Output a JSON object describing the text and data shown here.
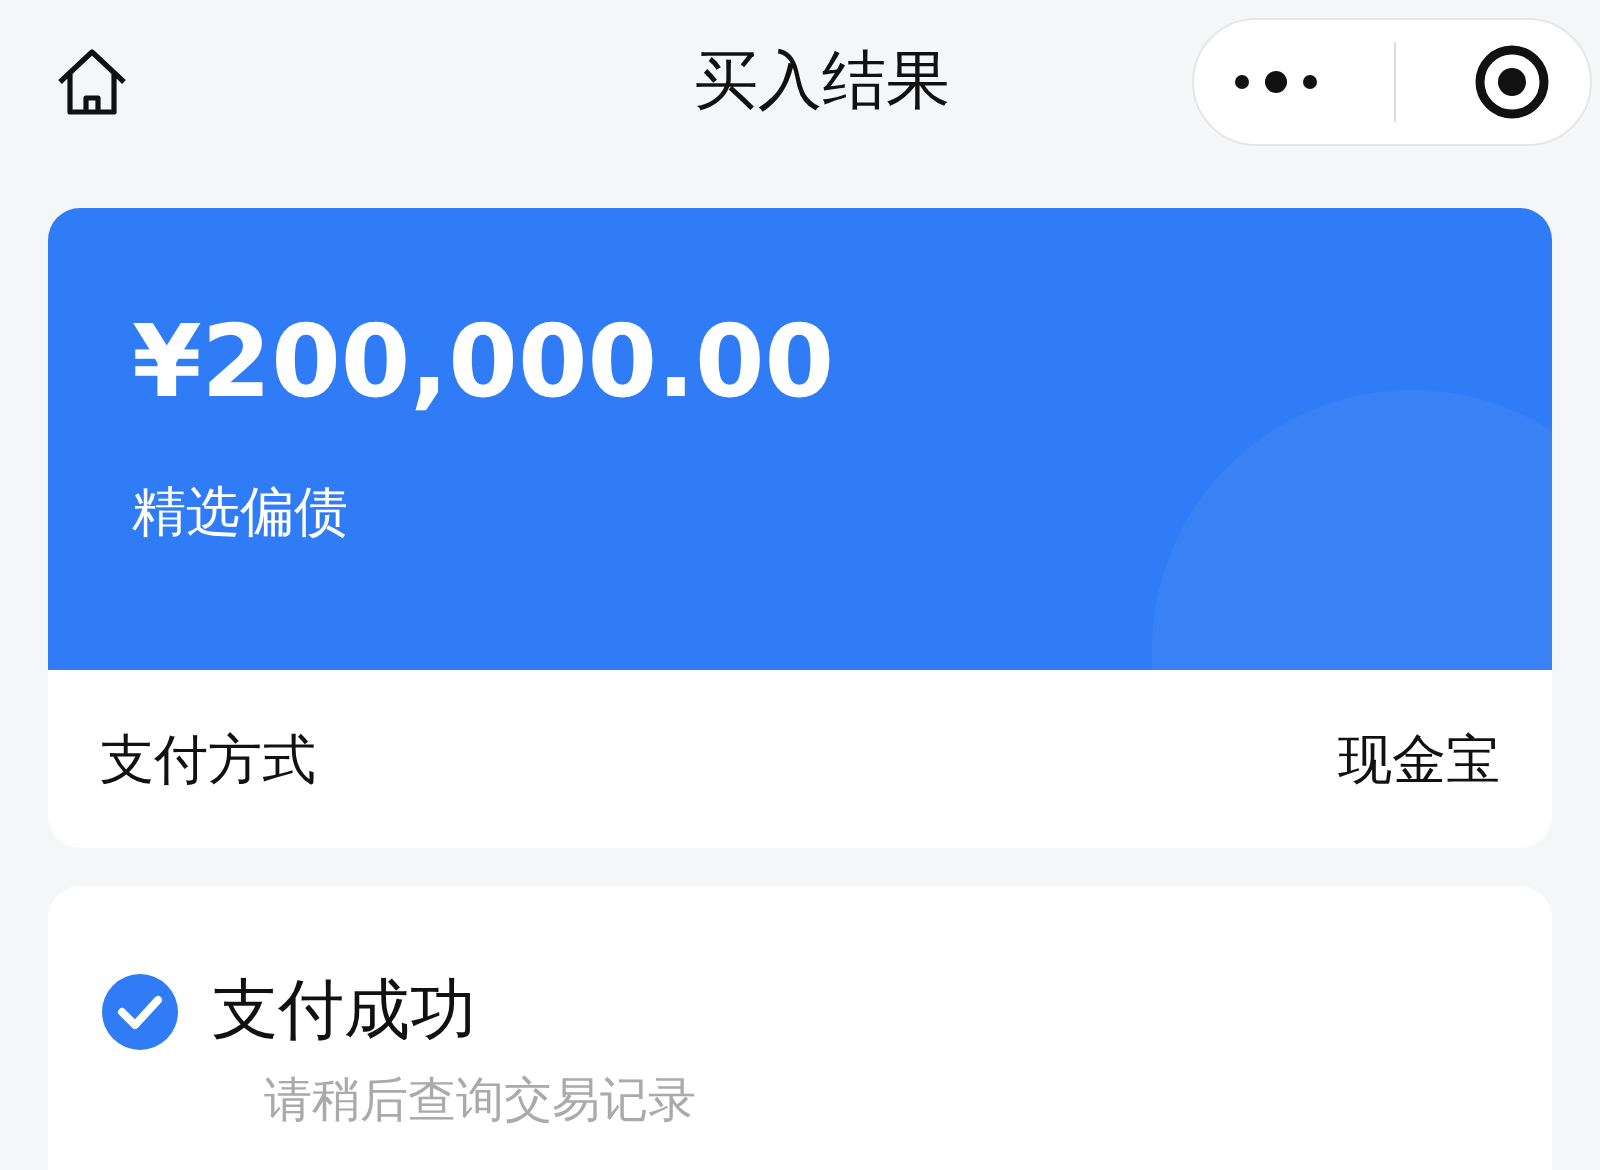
{
  "header": {
    "title": "买入结果"
  },
  "order": {
    "amount": "¥200,000.00",
    "product": "精选偏债",
    "payment_label": "支付方式",
    "payment_value": "现金宝"
  },
  "result": {
    "kind": "success",
    "title": "支付成功",
    "hint": "请稍后查询交易记录"
  }
}
